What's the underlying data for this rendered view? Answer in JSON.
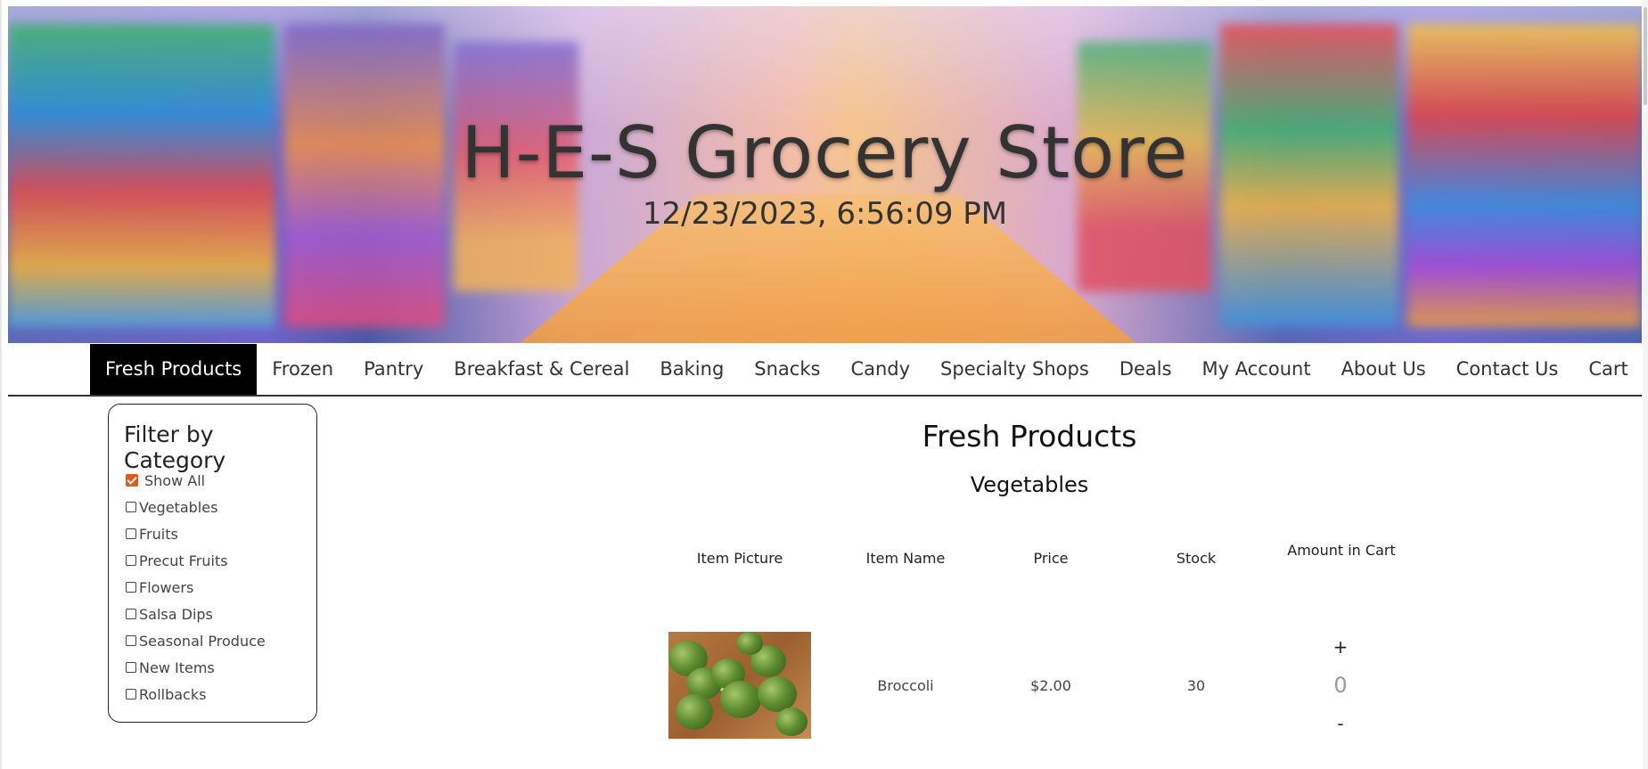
{
  "header": {
    "title": "H-E-S Grocery Store",
    "datetime": "12/23/2023, 6:56:09 PM"
  },
  "nav": {
    "items": [
      {
        "label": "Fresh Products",
        "active": true
      },
      {
        "label": "Frozen"
      },
      {
        "label": "Pantry"
      },
      {
        "label": "Breakfast & Cereal"
      },
      {
        "label": "Baking"
      },
      {
        "label": "Snacks"
      },
      {
        "label": "Candy"
      },
      {
        "label": "Specialty Shops"
      },
      {
        "label": "Deals"
      },
      {
        "label": "My Account"
      },
      {
        "label": "About Us"
      },
      {
        "label": "Contact Us"
      },
      {
        "label": "Cart"
      }
    ]
  },
  "filter": {
    "title": "Filter by Category",
    "options": [
      {
        "label": "Show All",
        "checked": true
      },
      {
        "label": "Vegetables",
        "checked": false
      },
      {
        "label": "Fruits",
        "checked": false
      },
      {
        "label": "Precut Fruits",
        "checked": false
      },
      {
        "label": "Flowers",
        "checked": false
      },
      {
        "label": "Salsa Dips",
        "checked": false
      },
      {
        "label": "Seasonal Produce",
        "checked": false
      },
      {
        "label": "New Items",
        "checked": false
      },
      {
        "label": "Rollbacks",
        "checked": false
      }
    ],
    "checked_color": "#e2571f"
  },
  "main": {
    "title": "Fresh Products",
    "section": "Vegetables",
    "columns": [
      "Item Picture",
      "Item Name",
      "Price",
      "Stock",
      "Amount in Cart"
    ],
    "rows": [
      {
        "picture_icon": "broccoli-photo",
        "name": "Broccoli",
        "price": "$2.00",
        "stock": "30",
        "amount": "0",
        "plus": "+",
        "minus": "-"
      }
    ]
  },
  "colors": {
    "nav_active_bg": "#000000",
    "nav_active_text": "#ffffff"
  }
}
